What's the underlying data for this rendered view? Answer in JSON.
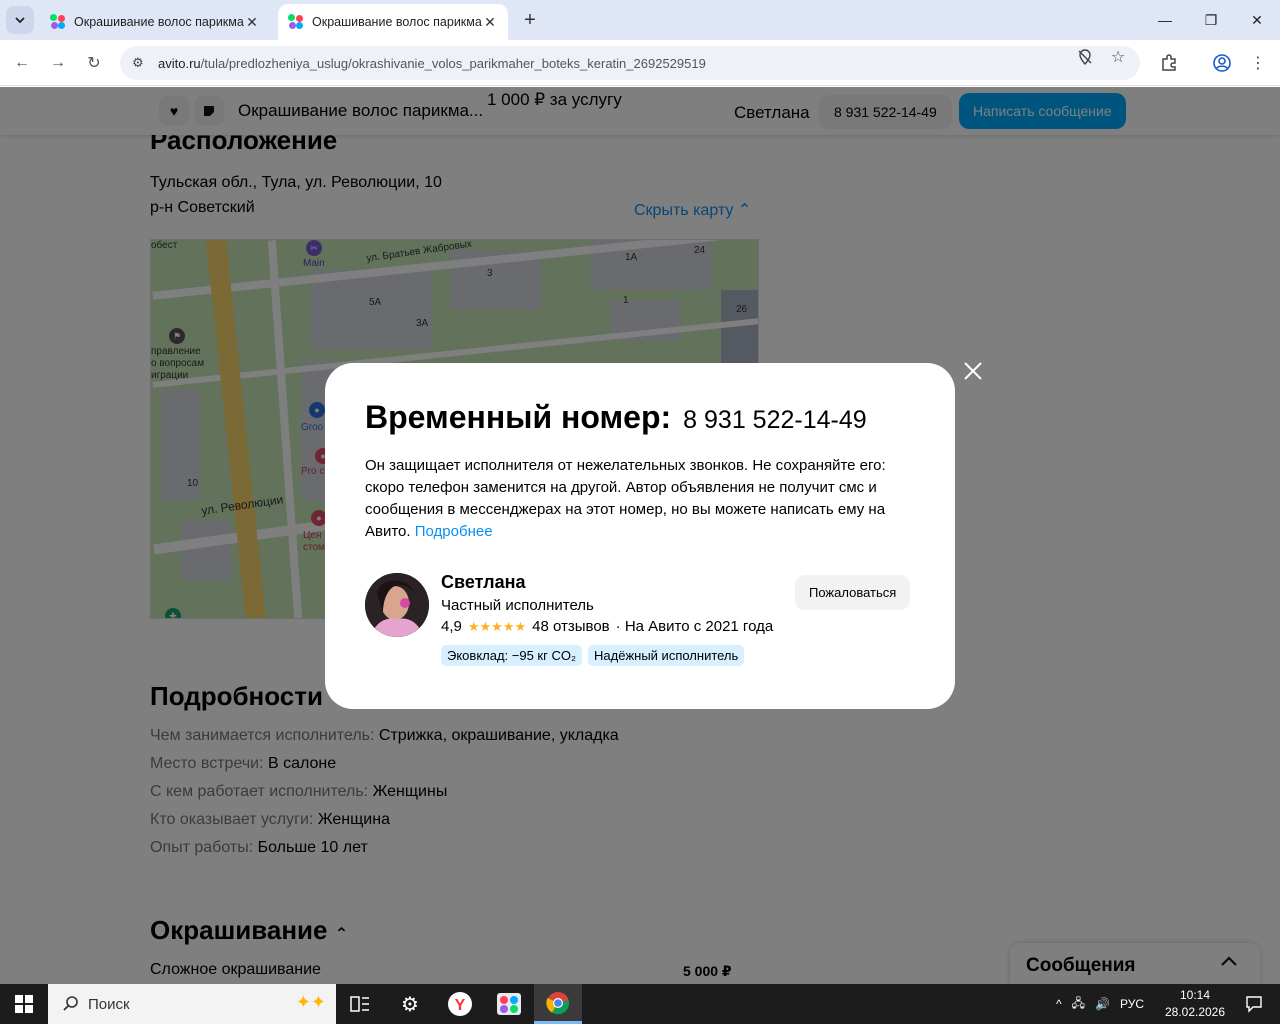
{
  "browser": {
    "tabs": [
      {
        "title": "Окрашивание волос парикмах",
        "active": false
      },
      {
        "title": "Окрашивание волос парикмах",
        "active": true
      }
    ],
    "url_host": "avito.ru",
    "url_path": "/tula/predlozheniya_uslug/okrashivanie_volos_parikmaher_boteks_keratin_2692529519"
  },
  "sticky": {
    "title": "Окрашивание волос парикма...",
    "price": "1 000 ₽ за услугу",
    "seller": "Светлана",
    "phone": "8 931 522-14-49",
    "message_button": "Написать сообщение"
  },
  "location": {
    "heading": "Расположение",
    "address": "Тульская обл., Тула, ул. Революции, 10",
    "district": "р-н Советский",
    "hide_map": "Скрыть карту",
    "map_labels": {
      "street1": "ул. Братьев Жабровых",
      "street2": "ул. Революции",
      "b3": "3",
      "b5a": "5А",
      "b3a": "3А",
      "b1a": "1А",
      "b1": "1",
      "b24": "24",
      "b26": "26",
      "b10": "10",
      "main": "Main",
      "groom": "Groo",
      "pro": "Pro c",
      "gov": "правление\nо вопросам\nиграции",
      "obest": "обест",
      "dent": "Цен\nстомат"
    }
  },
  "details": {
    "heading": "Подробности",
    "rows": [
      {
        "key": "Чем занимается исполнитель:",
        "value": "Стрижка, окрашивание, укладка"
      },
      {
        "key": "Место встречи:",
        "value": "В салоне"
      },
      {
        "key": "С кем работает исполнитель:",
        "value": "Женщины"
      },
      {
        "key": "Кто оказывает услуги:",
        "value": "Женщина"
      },
      {
        "key": "Опыт работы:",
        "value": "Больше 10 лет"
      }
    ]
  },
  "coloring": {
    "heading": "Окрашивание",
    "item_label": "Сложное окрашивание",
    "item_price": "5 000 ₽"
  },
  "messages_panel": {
    "title": "Сообщения"
  },
  "modal": {
    "heading": "Временный номер:",
    "number": "8 931 522-14-49",
    "description": "Он защищает исполнителя от нежелательных звонков. Не сохраняйте его: скоро телефон заменится на другой. Автор объявления не получит смс и сообщения в мессенджерах на этот номер, но вы можете написать ему на Авито.",
    "more_link": "Подробнее",
    "seller_name": "Светлана",
    "seller_role": "Частный исполнитель",
    "rating": "4,9",
    "stars": "★★★★★",
    "reviews": "48 отзывов",
    "since": "· На Авито с 2021 года",
    "badges": [
      "Эковклад: −95 кг CO₂",
      "Надёжный исполнитель"
    ],
    "report_button": "Пожаловаться"
  },
  "taskbar": {
    "search_placeholder": "Поиск",
    "lang": "РУС",
    "time": "10:14",
    "date": "28.02.2026"
  },
  "colors": {
    "accent": "#00aaff",
    "link": "#0a8ff0",
    "badge_bg": "#d6f0ff",
    "star": "#ffb021"
  }
}
